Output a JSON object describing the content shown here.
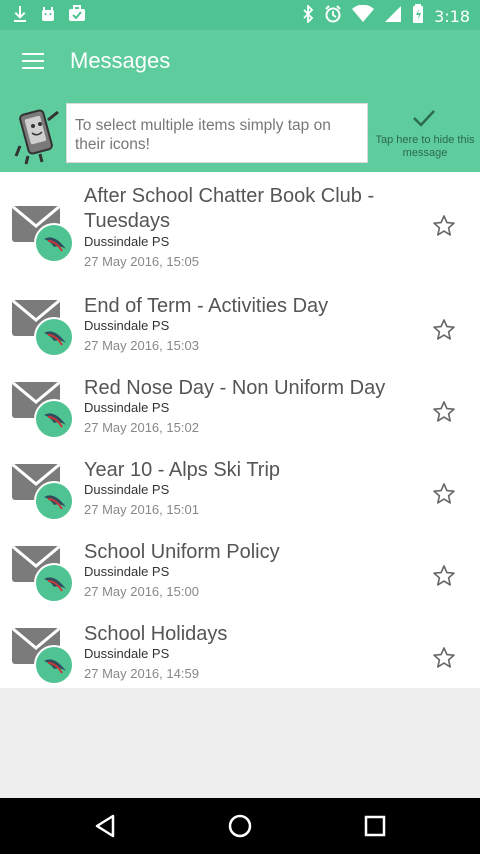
{
  "status_bar": {
    "time": "3:18",
    "left_icons": [
      "download-icon",
      "android-icon",
      "briefcase-icon"
    ],
    "right_icons": [
      "bluetooth-icon",
      "alarm-icon",
      "wifi-icon",
      "signal-icon",
      "battery-icon"
    ]
  },
  "app_bar": {
    "title": "Messages",
    "menu_icon": "menu-icon"
  },
  "tip": {
    "text": "To select multiple items simply tap on their icons!",
    "hide_label": "Tap here to hide this message",
    "hide_icon": "check-icon"
  },
  "messages": [
    {
      "title": "After School Chatter Book Club - Tuesdays",
      "sender": "Dussindale PS",
      "date": "27 May 2016, 15:05",
      "starred": false
    },
    {
      "title": "End of Term - Activities Day",
      "sender": "Dussindale PS",
      "date": "27 May 2016, 15:03",
      "starred": false
    },
    {
      "title": "Red Nose Day - Non Uniform Day",
      "sender": "Dussindale PS",
      "date": "27 May 2016, 15:02",
      "starred": false
    },
    {
      "title": "Year 10 - Alps Ski Trip",
      "sender": "Dussindale PS",
      "date": "27 May 2016, 15:01",
      "starred": false
    },
    {
      "title": "School Uniform Policy",
      "sender": "Dussindale PS",
      "date": "27 May 2016, 15:00",
      "starred": false
    },
    {
      "title": "School Holidays",
      "sender": "Dussindale PS",
      "date": "27 May 2016, 14:59",
      "starred": false
    }
  ],
  "nav_bar": {
    "icons": [
      "back-icon",
      "home-icon",
      "recents-icon"
    ]
  },
  "colors": {
    "primary": "#5ecc9c",
    "status": "#4fc492",
    "envelope": "#7b7b7b"
  }
}
